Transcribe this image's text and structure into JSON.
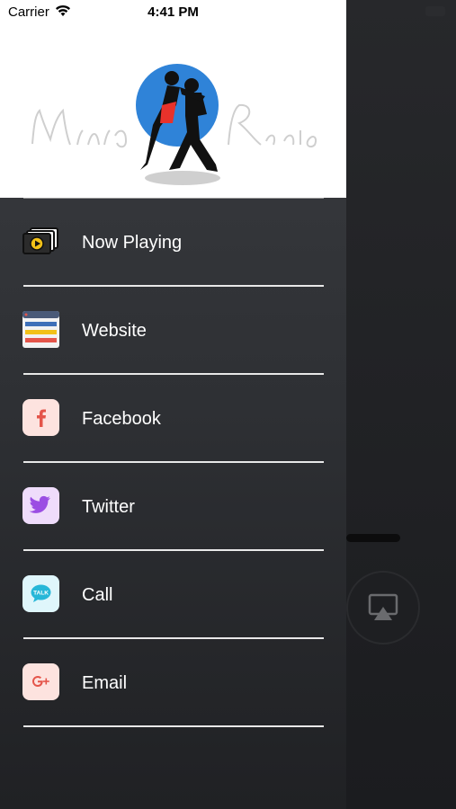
{
  "status_bar": {
    "carrier": "Carrier",
    "time": "4:41 PM"
  },
  "menu": [
    {
      "id": "now-playing",
      "label": "Now Playing",
      "icon": "play-window-icon"
    },
    {
      "id": "website",
      "label": "Website",
      "icon": "browser-window-icon"
    },
    {
      "id": "facebook",
      "label": "Facebook",
      "icon": "facebook-icon"
    },
    {
      "id": "twitter",
      "label": "Twitter",
      "icon": "twitter-bird-icon"
    },
    {
      "id": "call",
      "label": "Call",
      "icon": "talk-bubble-icon"
    },
    {
      "id": "email",
      "label": "Email",
      "icon": "google-plus-icon"
    }
  ],
  "colors": {
    "facebook": "#e4554a",
    "twitter": "#9b4ee3",
    "call": "#27b7d8",
    "email": "#e4554a",
    "logo_blue": "#2f83d8"
  }
}
